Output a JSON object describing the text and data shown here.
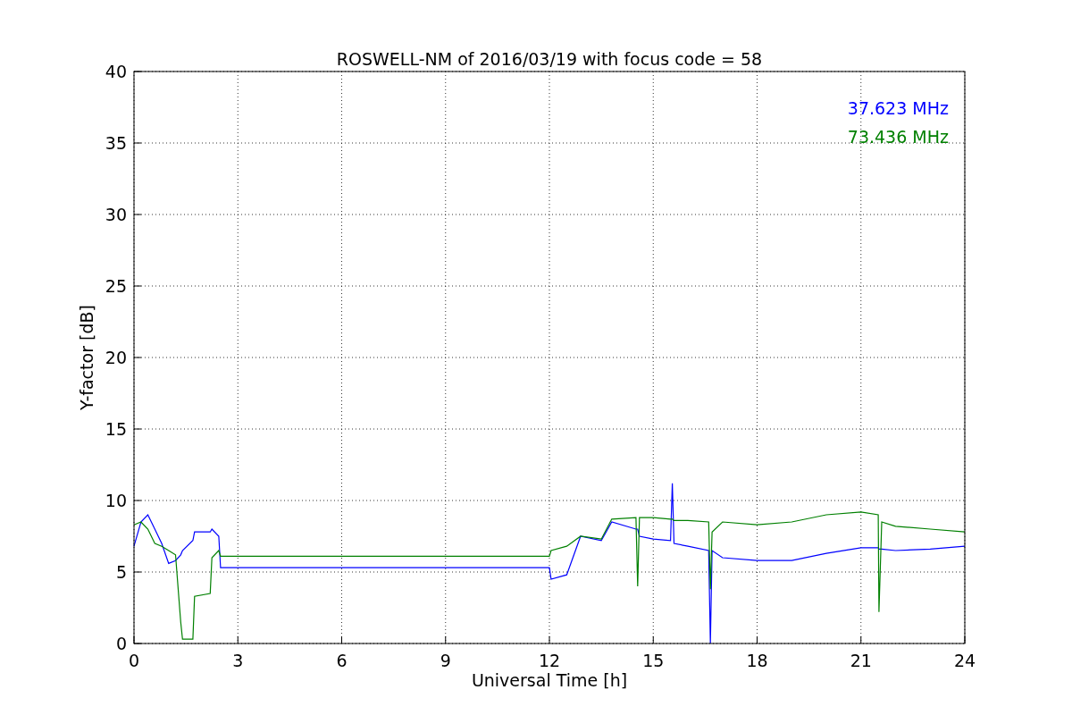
{
  "chart_data": {
    "type": "line",
    "title": "ROSWELL-NM of 2016/03/19 with focus code = 58",
    "xlabel": "Universal Time [h]",
    "ylabel": "Y-factor [dB]",
    "x": [
      0,
      0.2,
      0.4,
      0.6,
      0.8,
      1.0,
      1.2,
      1.35,
      1.4,
      1.7,
      1.75,
      2.2,
      2.25,
      2.45,
      2.5,
      12,
      12.05,
      12.5,
      12.9,
      13.5,
      13.8,
      14.5,
      14.55,
      14.6,
      15,
      15.5,
      15.55,
      15.6,
      16,
      16.6,
      16.65,
      16.7,
      17,
      18,
      19,
      20,
      21,
      21.5,
      21.52,
      21.6,
      22,
      23,
      24
    ],
    "series": [
      {
        "name": "37.623 MHz",
        "color": "#0000ff",
        "values": [
          6.8,
          8.5,
          9,
          8,
          7,
          5.6,
          5.8,
          6.2,
          6.5,
          7.2,
          7.8,
          7.8,
          8,
          7.5,
          5.3,
          5.3,
          4.5,
          4.8,
          7.5,
          7.2,
          8.5,
          8,
          8,
          7.5,
          7.3,
          7.2,
          11.2,
          7,
          6.8,
          6.5,
          0,
          6.5,
          6,
          5.8,
          5.8,
          6.3,
          6.7,
          6.7,
          6.6,
          6.6,
          6.5,
          6.6,
          6.8
        ]
      },
      {
        "name": "73.436 MHz",
        "color": "#008000",
        "values": [
          8.3,
          8.5,
          8,
          7,
          6.8,
          6.5,
          6.2,
          1.5,
          0.3,
          0.3,
          3.3,
          3.5,
          6,
          6.5,
          6.1,
          6.1,
          6.5,
          6.8,
          7.5,
          7.3,
          8.7,
          8.8,
          4,
          8.8,
          8.8,
          8.7,
          8.7,
          8.6,
          8.6,
          8.5,
          3.8,
          7.8,
          8.5,
          8.3,
          8.5,
          9,
          9.2,
          9,
          2.2,
          8.5,
          8.2,
          8,
          7.8
        ]
      }
    ],
    "xlim": [
      0,
      24
    ],
    "ylim": [
      0,
      40
    ],
    "xticks": [
      0,
      3,
      6,
      9,
      12,
      15,
      18,
      21,
      24
    ],
    "yticks": [
      0,
      5,
      10,
      15,
      20,
      25,
      30,
      35,
      40
    ],
    "grid": true
  }
}
